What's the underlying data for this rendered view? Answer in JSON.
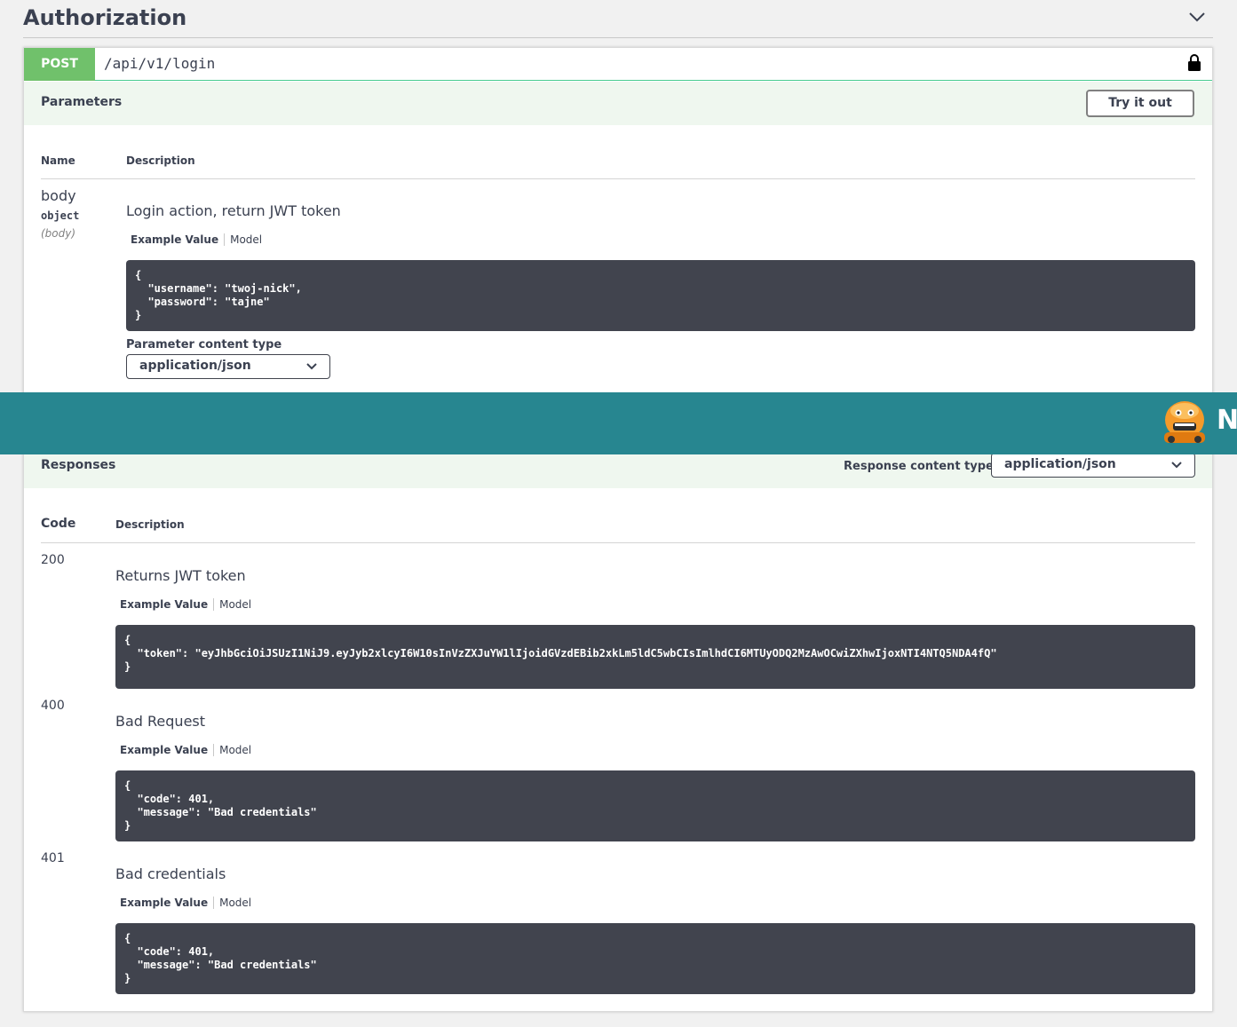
{
  "section": {
    "title": "Authorization"
  },
  "operation": {
    "method": "POST",
    "path": "/api/v1/login"
  },
  "parameters": {
    "title": "Parameters",
    "try_label": "Try it out",
    "col_name": "Name",
    "col_description": "Description",
    "param": {
      "name": "body",
      "type": "object",
      "in": "(body)",
      "description": "Login action, return JWT token",
      "tab_example": "Example Value",
      "tab_model": "Model",
      "example": "{\n  \"username\": \"twoj-nick\",\n  \"password\": \"tajne\"\n}"
    },
    "content_type_label": "Parameter content type",
    "content_type_value": "application/json"
  },
  "banner": {
    "text": "Ne"
  },
  "responses": {
    "title": "Responses",
    "content_type_label": "Response content type",
    "content_type_value": "application/json",
    "col_code": "Code",
    "col_description": "Description",
    "items": [
      {
        "code": "200",
        "description": "Returns JWT token",
        "tab_example": "Example Value",
        "tab_model": "Model",
        "example": "{\n  \"token\": \"eyJhbGciOiJSUzI1NiJ9.eyJyb2xlcyI6W10sInVzZXJuYW1lIjoidGVzdEBib2xkLm5ldC5wbCIsImlhdCI6MTUyODQ2MzAwOCwiZXhwIjoxNTI4NTQ5NDA4fQ\"\n}"
      },
      {
        "code": "400",
        "description": "Bad Request",
        "tab_example": "Example Value",
        "tab_model": "Model",
        "example": "{\n  \"code\": 401,\n  \"message\": \"Bad credentials\"\n}"
      },
      {
        "code": "401",
        "description": "Bad credentials",
        "tab_example": "Example Value",
        "tab_model": "Model",
        "example": "{\n  \"code\": 401,\n  \"message\": \"Bad credentials\"\n}"
      }
    ]
  },
  "colors": {
    "post": "#70c16b",
    "band": "#eff7ef",
    "code_bg": "#41444e",
    "banner": "#278690"
  }
}
